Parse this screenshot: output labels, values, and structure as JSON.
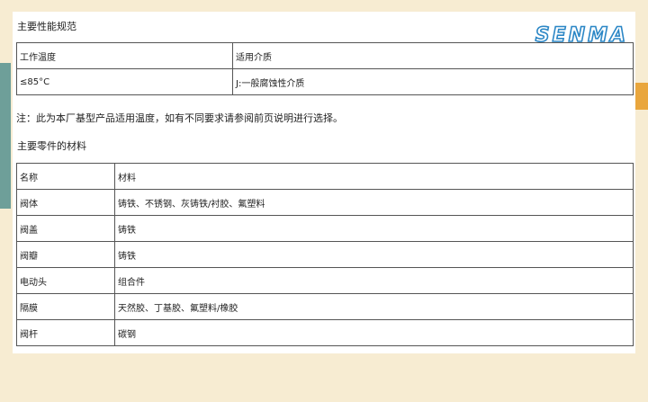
{
  "brand": {
    "logo_text": "SENMA"
  },
  "performance": {
    "title": "主要性能规范",
    "headers": [
      "工作温度",
      "适用介质"
    ],
    "row": [
      "≤85°C",
      "J:一般腐蚀性介质"
    ]
  },
  "note": "注：此为本厂基型产品适用温度，如有不同要求请参阅前页说明进行选择。",
  "materials": {
    "title": "主要零件的材料",
    "rows": [
      [
        "名称",
        "材料"
      ],
      [
        "阀体",
        "铸铁、不锈钢、灰铸铁/衬胶、氟塑料"
      ],
      [
        "阀盖",
        "铸铁"
      ],
      [
        "阀瓣",
        "铸铁"
      ],
      [
        "电动头",
        "组合件"
      ],
      [
        "隔膜",
        "天然胶、丁基胶、氟塑料/橡胶"
      ],
      [
        "阀杆",
        "碳钢"
      ]
    ]
  },
  "colors": {
    "background": "#f7ecd2",
    "accent_teal": "#6e9f99",
    "accent_orange": "#e9a63d",
    "logo_blue": "#2c87c6"
  }
}
